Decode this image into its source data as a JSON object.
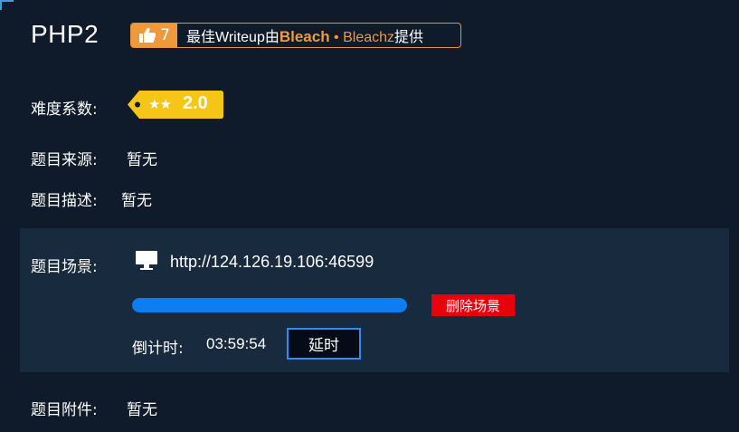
{
  "challenge": {
    "title": "PHP2"
  },
  "writeup": {
    "like_count": "7",
    "prefix": "最佳Writeup由",
    "author": "Bleach",
    "separator": " • ",
    "author2": "Bleachz",
    "suffix": "提供",
    "accent_color": "#ee9a3c"
  },
  "difficulty": {
    "label": "难度系数:",
    "stars": "★★",
    "value": "2.0",
    "tag_color": "#f5c518"
  },
  "source": {
    "label": "题目来源:",
    "value": "暂无"
  },
  "description": {
    "label": "题目描述:",
    "value": "暂无"
  },
  "scene": {
    "label": "题目场景:",
    "icon": "monitor-icon",
    "url": "http://124.126.19.106:46599",
    "progress": 1.0,
    "delete_label": "删除场景",
    "countdown_label": "倒计时:",
    "countdown_value": "03:59:54",
    "extend_label": "延时",
    "progress_color": "#0d7ef0",
    "delete_color": "#e8000b"
  },
  "attachment": {
    "label": "题目附件:",
    "value": "暂无"
  }
}
